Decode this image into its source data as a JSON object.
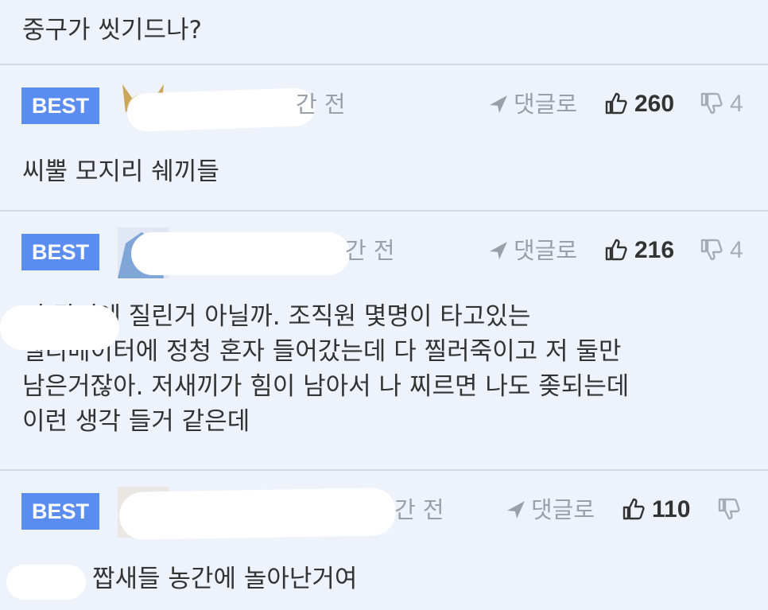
{
  "top_comment": {
    "text": "중구가 씻기드나?"
  },
  "comments": [
    {
      "badge": "BEST",
      "time": "간 전",
      "reply_label": "댓글로",
      "likes": "260",
      "dislikes": "4",
      "text": "씨뿔 모지리 쉐끼들"
    },
    {
      "badge": "BEST",
      "time": "간 전",
      "reply_label": "댓글로",
      "likes": "216",
      "dislikes": "4",
      "text": "저 광기에 질린거 아닐까. 조직원 몇명이 타고있는\n엘리베이터에 정청 혼자 들어갔는데 다 찔러죽이고 저 둘만\n남은거잖아. 저새끼가 힘이 남아서 나 찌르면 나도 좆되는데\n이런 생각 들거 같은데"
    },
    {
      "badge": "BEST",
      "time": "간 전",
      "reply_label": "댓글로",
      "likes": "110",
      "dislikes": "",
      "text": "짭새들 농간에 놀아난거여"
    }
  ],
  "colors": {
    "background": "#eef2fb",
    "badge": "#5b8df0",
    "divider": "#d4d8e0",
    "muted": "#9aa0aa",
    "text": "#333333"
  },
  "icons": {
    "reply": "arrow-icon",
    "like": "thumbs-up-icon",
    "dislike": "thumbs-down-icon"
  }
}
